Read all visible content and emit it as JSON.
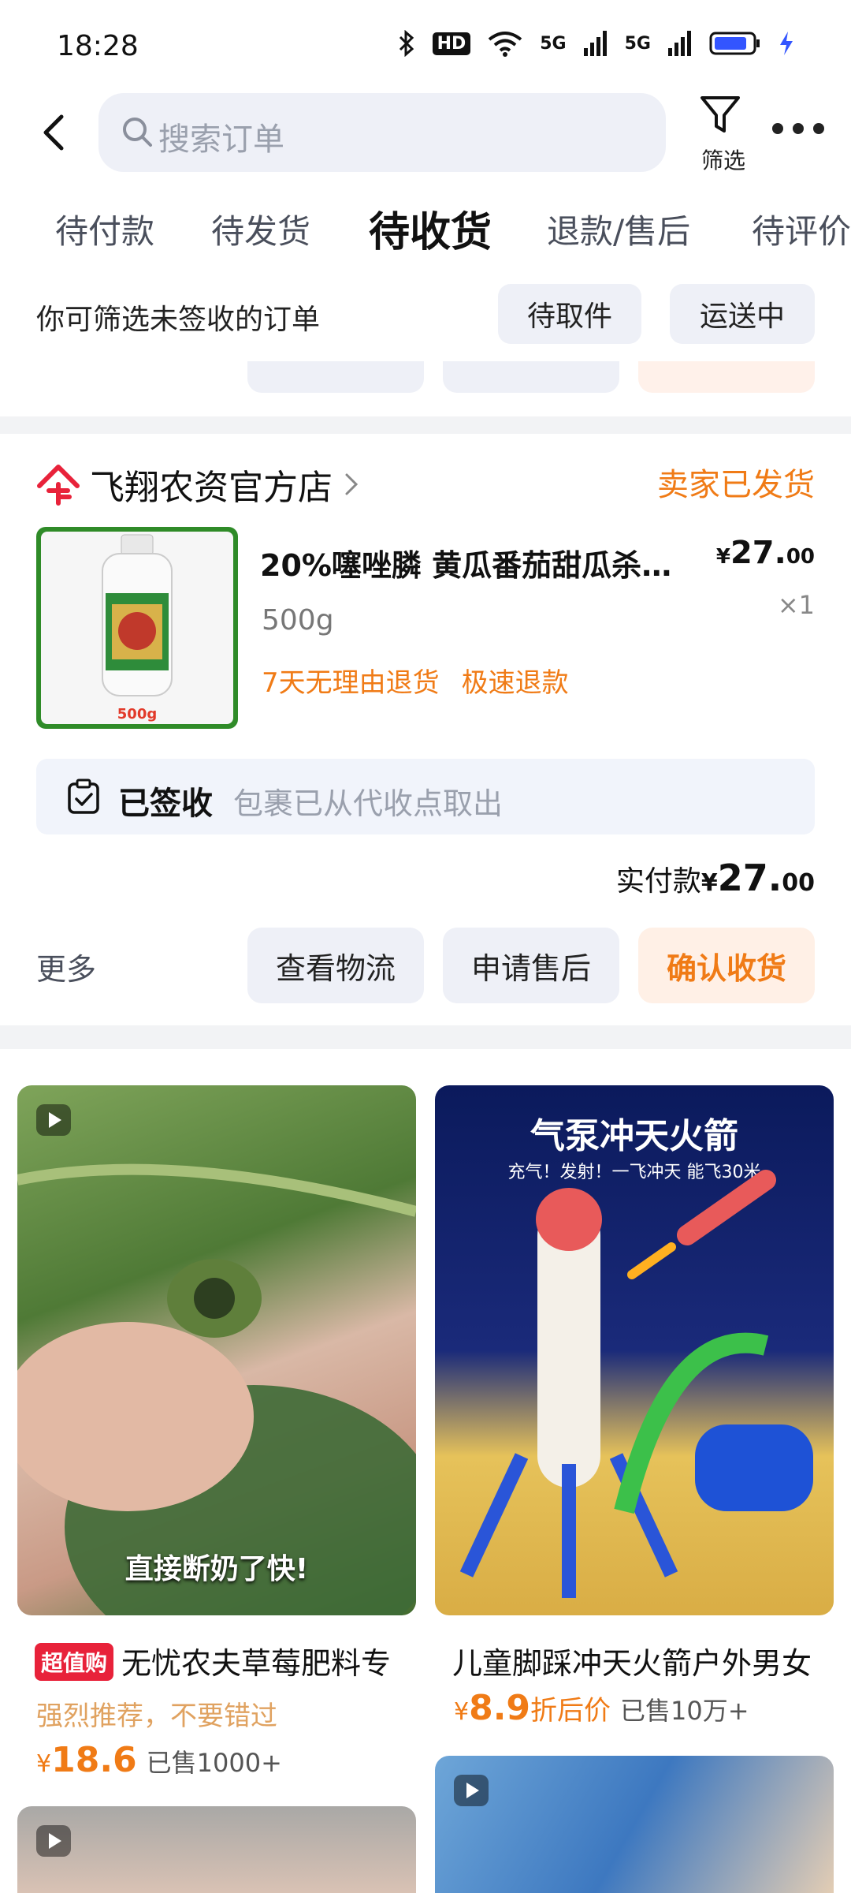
{
  "status_bar": {
    "time": "18:28",
    "icons": [
      "bluetooth-icon",
      "hd-icon",
      "wifi-icon",
      "5g-signal-icon",
      "5g-signal-icon",
      "battery-icon",
      "charging-icon"
    ],
    "hd_label": "HD",
    "g1": "5G",
    "g2": "5G"
  },
  "header": {
    "search_placeholder": "搜索订单",
    "filter_label": "筛选"
  },
  "tabs": [
    {
      "label": "待付款"
    },
    {
      "label": "待发货"
    },
    {
      "label": "待收货",
      "active": true
    },
    {
      "label": "退款/售后"
    },
    {
      "label": "待评价"
    }
  ],
  "filter_row": {
    "hint": "你可筛选未签收的订单",
    "chips": [
      "待取件",
      "运送中"
    ]
  },
  "order": {
    "shop_name": "飞翔农资官方店",
    "status": "卖家已发货",
    "product_title": "20%噻唑膦 黄瓜番茄甜瓜杀根结...",
    "thumb_label": "500g",
    "spec": "500g",
    "price_symbol": "¥",
    "price_int": "27.",
    "price_dec": "00",
    "quantity": "×1",
    "tags": [
      "7天无理由退货",
      "极速退款"
    ],
    "signed_label": "已签收",
    "signed_desc": "包裹已从代收点取出",
    "paid_label": "实付款",
    "paid_symbol": "¥",
    "paid_int": "27.",
    "paid_dec": "00",
    "more": "更多",
    "actions": [
      "查看物流",
      "申请售后",
      "确认收货"
    ]
  },
  "recommendations": [
    {
      "caption": "直接断奶了快!",
      "badge": "超值购",
      "title": "无忧农夫草莓肥料专",
      "subtitle": "强烈推荐，不要错过",
      "price_symbol": "¥",
      "price": "18.6",
      "sold": "已售1000+"
    },
    {
      "banner_title": "气泵冲天火箭",
      "banner_sub": "充气！发射！一飞冲天 能飞30米",
      "title": "儿童脚踩冲天火箭户外男女",
      "price_symbol": "¥",
      "price": "8.9",
      "discount_label": "折后价",
      "sold": "已售10万+"
    }
  ],
  "colors": {
    "accent": "#f07b16",
    "badge_red": "#e8223a",
    "chip_bg": "#eef0f7"
  }
}
